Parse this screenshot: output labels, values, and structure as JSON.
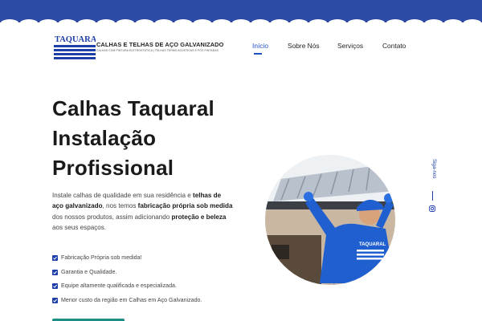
{
  "brand": {
    "title": "CALHAS E TELHAS DE AÇO GALVANIZADO",
    "subtitle": "CALHAS COM PINTURA ELETROSTÁTICA | TELHAS TERMO ACÚSTICAS E PÓS PINTADAS",
    "logo_text": "TAQUARAL",
    "logo_icon": "taquaral-logo"
  },
  "nav": {
    "items": [
      {
        "label": "Início",
        "active": true
      },
      {
        "label": "Sobre Nós",
        "active": false
      },
      {
        "label": "Serviços",
        "active": false
      },
      {
        "label": "Contato",
        "active": false
      }
    ]
  },
  "hero": {
    "title_lines": [
      "Calhas Taquaral",
      "Instalação",
      "Profissional"
    ],
    "description": {
      "p1": "Instale calhas de qualidade em sua residência e ",
      "b1": "telhas de aço galvanizado",
      "p2": ", nos temos ",
      "b2": "fabricação própria sob medida",
      "p3": " dos nossos produtos, assim adicionando ",
      "b3": "proteção e beleza",
      "p4": " aos seus espaços."
    }
  },
  "features": [
    "Fabricação Própria sob medida!",
    "Garantia e Qualidade.",
    "Equipe altamente qualificada e especializada.",
    "Menor custo da região em Calhas em Aço Galvanizado."
  ],
  "photo": {
    "badge_text": "TAQUARAL"
  },
  "social": {
    "label": "Siga-nos",
    "icon": "instagram-icon"
  },
  "colors": {
    "primary": "#1e3fa8",
    "accent_blue": "#1e4fbf",
    "teal": "#1c8e84",
    "text": "#1a1a1a"
  }
}
